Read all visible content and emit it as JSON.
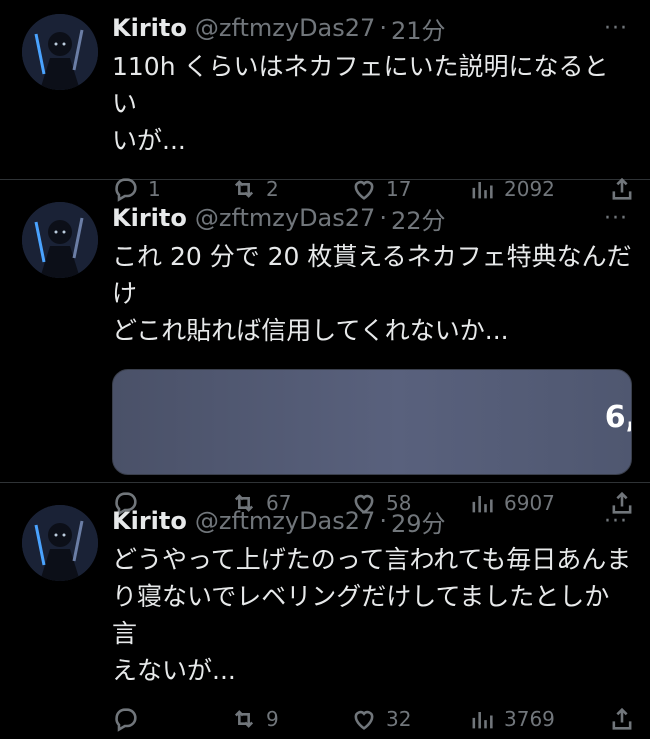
{
  "tweets": [
    {
      "name": "Kirito",
      "handle": "@zftmzyDas27",
      "time": "21分",
      "text": "110h くらいはネカフェにいた説明になるとい\nいが...",
      "replies": "1",
      "retweets": "2",
      "likes": "17",
      "views": "2092"
    },
    {
      "name": "Kirito",
      "handle": "@zftmzyDas27",
      "time": "22分",
      "text": "これ 20 分で 20 枚貰えるネカフェ特典なんだけ\nどこれ貼れば信用してくれないか...",
      "media_text": "6,",
      "replies": "",
      "retweets": "67",
      "likes": "58",
      "views": "6907"
    },
    {
      "name": "Kirito",
      "handle": "@zftmzyDas27",
      "time": "29分",
      "text": "どうやって上げたのって言われても毎日あんま\nり寝ないでレベリングだけしてましたとしか言\nえないが...",
      "replies": "",
      "retweets": "9",
      "likes": "32",
      "views": "3769"
    }
  ],
  "dot": "·",
  "more": "···",
  "colors": {
    "background": "#000000",
    "text": "#e7e9ea",
    "muted": "#71767b",
    "border": "#2f3336"
  },
  "icons": [
    "reply-icon",
    "retweet-icon",
    "like-icon",
    "views-icon",
    "share-icon",
    "more-icon"
  ]
}
